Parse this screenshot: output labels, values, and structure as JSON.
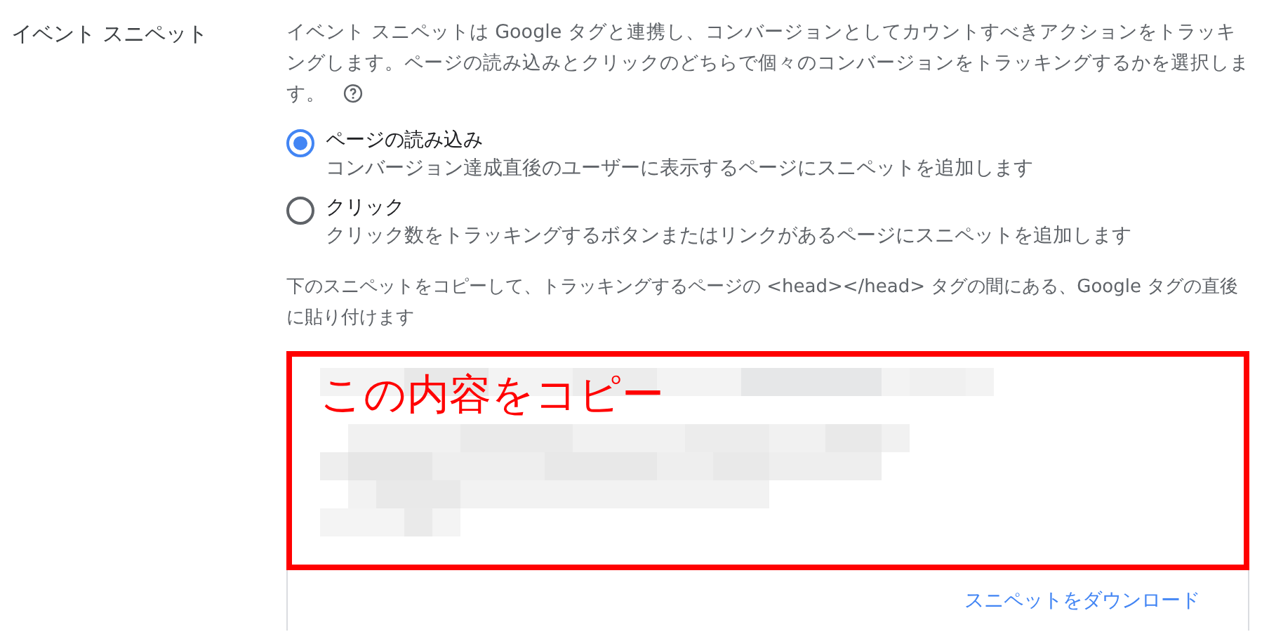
{
  "section_label": "イベント スニペット",
  "description": "イベント スニペットは Google タグと連携し、コンバージョンとしてカウントすべきアクションをトラッキングします。ページの読み込みとクリックのどちらで個々のコンバージョンをトラッキングするかを選択します。",
  "options": [
    {
      "label": "ページの読み込み",
      "hint": "コンバージョン達成直後のユーザーに表示するページにスニペットを追加します",
      "selected": true
    },
    {
      "label": "クリック",
      "hint": "クリック数をトラッキングするボタンまたはリンクがあるページにスニペットを追加します",
      "selected": false
    }
  ],
  "instruction": "下のスニペットをコピーして、トラッキングするページの <head></head> タグの間にある、Google タグの直後に貼り付けます",
  "snippet": {
    "annotation": "この内容をコピー"
  },
  "download_link": "スニペットをダウンロード"
}
